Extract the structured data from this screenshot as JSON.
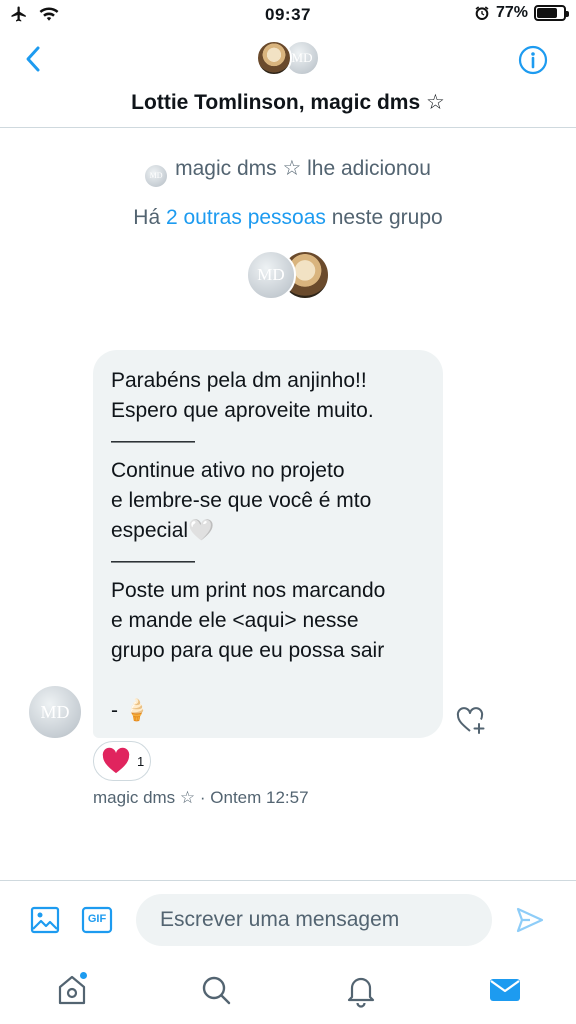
{
  "status_bar": {
    "time": "09:37",
    "battery": "77%",
    "battery_fraction": 0.77,
    "icons": [
      "airplane-icon",
      "wifi-icon",
      "alarm-icon",
      "battery-icon"
    ]
  },
  "header": {
    "title": "Lottie Tomlinson, magic dms ☆",
    "avatar_md_text": "MD",
    "icons": [
      "chevron-left-icon",
      "info-icon"
    ]
  },
  "system": {
    "added_text": "magic dms ☆ lhe adicionou",
    "others_prefix": "Há ",
    "others_link": "2 outras pessoas",
    "others_suffix": " neste grupo",
    "avatar_md_text": "MD"
  },
  "message": {
    "avatar_text": "MD",
    "lines": [
      "Parabéns pela dm anjinho!!",
      "Espero que aproveite muito.",
      "————",
      "Continue ativo no projeto",
      "e lembre-se que você é mto",
      "especial🤍",
      "————",
      "Poste um print nos marcando",
      "e mande ele <aqui> nesse",
      "grupo para que eu possa sair",
      "",
      "- 🍦"
    ],
    "reaction_count": "1",
    "sender": "magic dms ☆",
    "separator": " · ",
    "timestamp": "Ontem 12:57"
  },
  "composer": {
    "placeholder": "Escrever uma mensagem",
    "gif_label": "GIF",
    "icons": [
      "image-icon",
      "gif-icon",
      "send-icon"
    ]
  },
  "tabbar": {
    "icons": [
      "home-icon",
      "search-icon",
      "bell-icon",
      "mail-icon"
    ]
  },
  "colors": {
    "accent": "#1d9bf0",
    "bubble": "#eff3f4",
    "muted_text": "#536471",
    "heart": "#e0245e"
  }
}
